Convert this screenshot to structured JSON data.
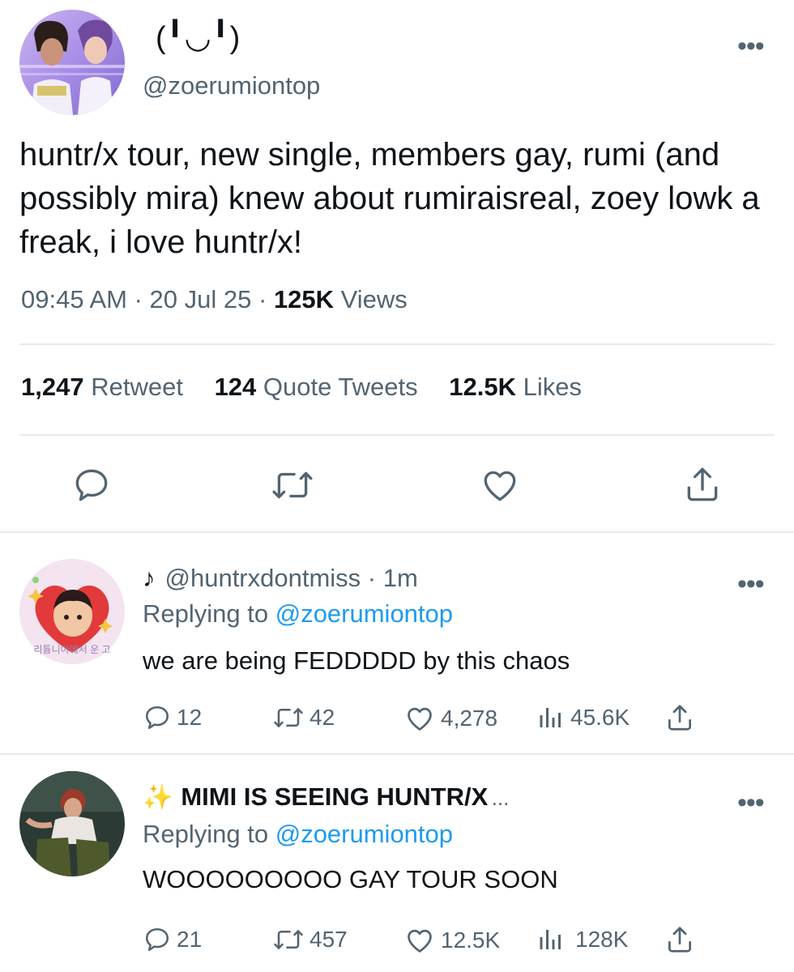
{
  "main_tweet": {
    "display_name": "(╹◡╹)",
    "handle": "@zoerumiontop",
    "text": "huntr/x tour, new single, members gay, rumi (and possibly mira) knew about rumiraisreal, zoey lowk a freak, i love huntr/x!",
    "time": "09:45 AM",
    "date": "20 Jul 25",
    "views_count": "125K",
    "views_label": "Views",
    "retweets_count": "1,247",
    "retweets_label": "Retweet",
    "quotes_count": "124",
    "quotes_label": "Quote Tweets",
    "likes_count": "12.5K",
    "likes_label": "Likes",
    "more_label": "•••"
  },
  "replies": [
    {
      "handle_line": "@huntrxdontmiss · 1m",
      "name_icon": "music-note-icon",
      "replying_prefix": "Replying to",
      "replying_to": "@zoerumiontop",
      "text": "we are being FEDDDDD by this chaos",
      "reply_count": "12",
      "retweet_count": "42",
      "like_count": "4,278",
      "views_count": "45.6K",
      "avatar_caption": "리튬니아에서 운 고"
    },
    {
      "name": "MIMI IS SEEING HUNTR/X",
      "name_ellipsis": "...",
      "name_icon": "sparkles-icon",
      "replying_prefix": "Replying to",
      "replying_to": "@zoerumiontop",
      "text": "WOOOOOOOOO GAY TOUR SOON",
      "reply_count": "21",
      "retweet_count": "457",
      "like_count": "12.5K",
      "views_count": "128K"
    }
  ],
  "colors": {
    "text": "#0f1419",
    "secondary": "#536471",
    "link": "#1d9bf0",
    "divider": "#e6ecf0"
  }
}
